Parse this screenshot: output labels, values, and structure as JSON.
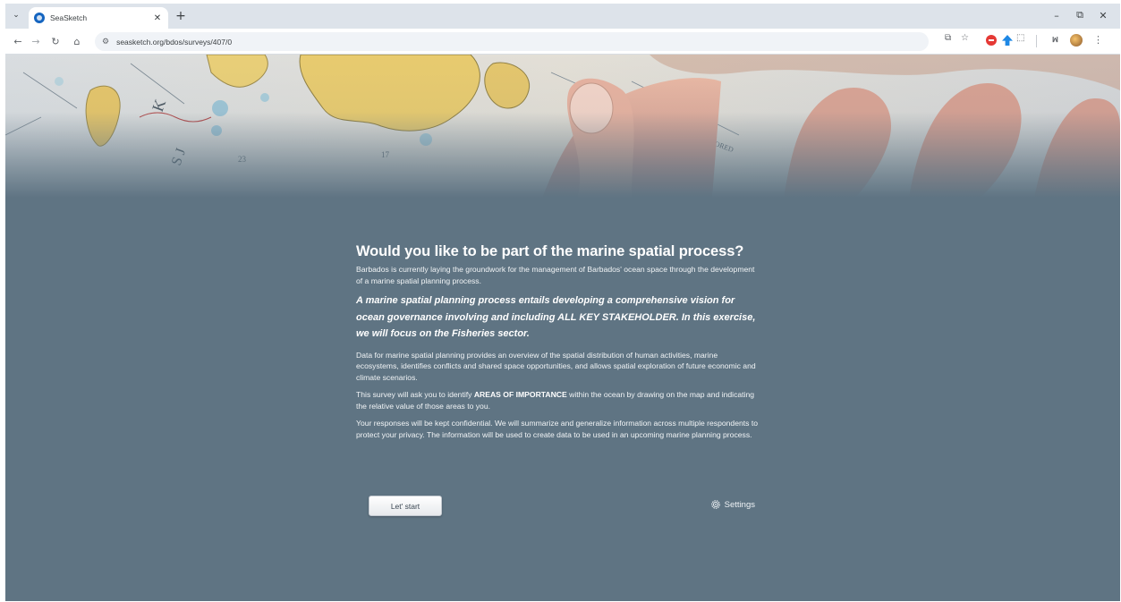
{
  "browser": {
    "tab_menu_icon": "⌄",
    "tab_title": "SeaSketch",
    "tab_close": "✕",
    "new_tab": "+",
    "window": {
      "minimize": "–",
      "restore": "⧉",
      "close": "✕"
    },
    "nav": {
      "back": "←",
      "forward": "→",
      "reload": "↻",
      "home": "⌂"
    },
    "site_info_icon": "⚙",
    "url": "seasketch.org/bdos/surveys/407/0",
    "extension_label": "ꟽ",
    "menu_icon": "⋮"
  },
  "survey": {
    "title": "Would you like to be part of the marine spatial process?",
    "intro": "Barbados is currently laying the groundwork for the management of Barbados' ocean space through the development of a marine spatial planning process.",
    "emphasis": "A marine spatial planning process entails developing a comprehensive vision for ocean governance involving and including ALL KEY STAKEHOLDER. In this exercise, we will focus on the Fisheries sector.",
    "data_paragraph": "Data for marine spatial planning provides an overview of the spatial distribution of human activities, marine ecosystems, identifies conflicts and shared space opportunities, and allows spatial exploration of future economic and climate scenarios.",
    "areas_before": "This survey will ask you to identify ",
    "areas_strong": "AREAS OF IMPORTANCE",
    "areas_after": " within the ocean by drawing on the map and indicating the relative value of those areas to you.",
    "privacy": "Your responses will be kept confidential. We will summarize and generalize information across multiple respondents to protect your privacy. The information will be used to create data to be used in an upcoming marine planning process.",
    "start_label": "Let' start",
    "settings_label": "Settings"
  },
  "colors": {
    "page_background": "#5f7483",
    "chrome_background": "#dde3ea"
  }
}
